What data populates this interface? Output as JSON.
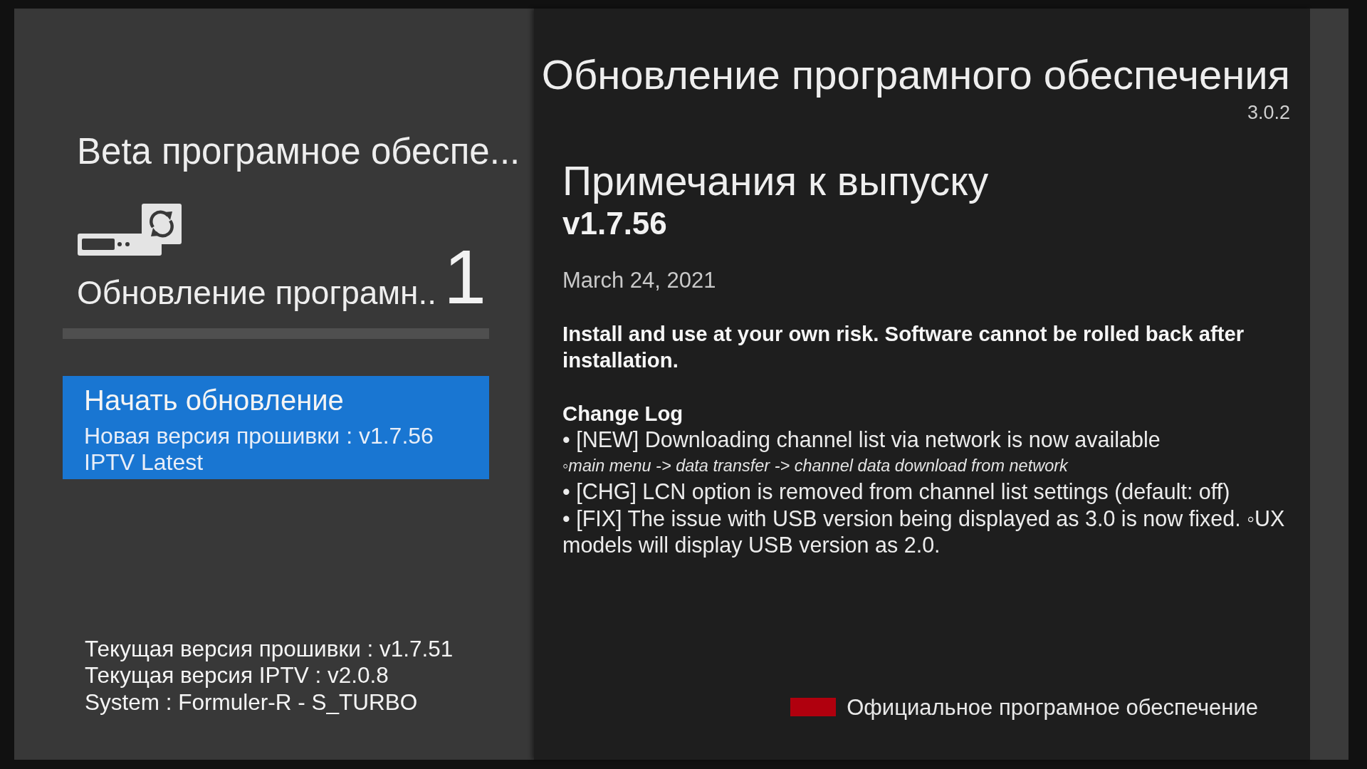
{
  "sidebar": {
    "title": "Beta програмное обеспе...",
    "update_item": {
      "label": "Обновление програмн..",
      "count": "1"
    },
    "progress": {
      "level": 0
    },
    "start_button": {
      "title": "Начать обновление",
      "lines": [
        "Новая версия прошивки : v1.7.56",
        "IPTV Latest"
      ],
      "selected": true
    },
    "info": [
      "Текущая версия прошивки : v1.7.51",
      "Текущая версия IPTV : v2.0.8",
      "System : Formuler-R - S_TURBO"
    ]
  },
  "main": {
    "title": "Обновление програмного обеспечения",
    "app_version": "3.0.2",
    "notes_heading": "Примечания к выпуску",
    "release_version": "v1.7.56",
    "release_date": "March 24, 2021",
    "warning": "Install and use at your own risk. Software cannot be rolled back after installation.",
    "changelog_heading": "Change Log",
    "changelog": [
      {
        "kind": "bullet",
        "text": "• [NEW] Downloading channel list via network is now available"
      },
      {
        "kind": "sub",
        "text": "◦main menu -> data transfer -> channel data download from network"
      },
      {
        "kind": "bullet",
        "text": "• [CHG] LCN option is removed from channel list settings (default: off)"
      },
      {
        "kind": "bullet",
        "text": "• [FIX] The issue with USB version being displayed as 3.0 is now fixed. ◦UX models will display USB version as 2.0."
      }
    ]
  },
  "legend": [
    {
      "color": "#b0000e",
      "label": "Официальное програмное обеспечение"
    }
  ]
}
